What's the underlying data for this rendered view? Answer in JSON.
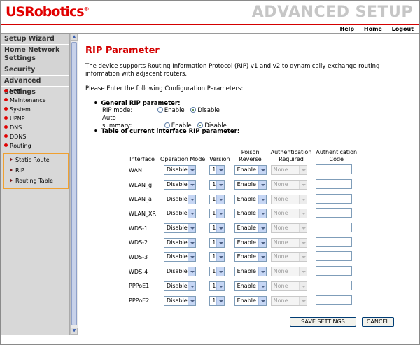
{
  "header": {
    "logo": "USRobotics",
    "logo_mark": "®",
    "title": "ADVANCED SETUP",
    "links": [
      "Help",
      "Home",
      "Logout"
    ]
  },
  "sidebar": {
    "heads": [
      "Setup Wizard",
      "Home Network Settings",
      "Security",
      "Advanced Settings"
    ],
    "items": [
      "NAT",
      "Maintenance",
      "System",
      "UPNP",
      "DNS",
      "DDNS",
      "Routing"
    ],
    "submenu": [
      "Static Route",
      "RIP",
      "Routing Table"
    ]
  },
  "main": {
    "title": "RIP Parameter",
    "description": "The device supports Routing Information Protocol (RIP) v1 and v2 to dynamically exchange routing information with adjacent routers.",
    "intro": "Please Enter the following Configuration Parameters:",
    "general_title": "General RIP parameter:",
    "rip_mode": {
      "label": "RIP mode:",
      "options": [
        "Enable",
        "Disable"
      ],
      "selected": "Disable"
    },
    "auto_summary": {
      "label": "Auto summary:",
      "options": [
        "Enable",
        "Disable"
      ],
      "selected": "Disable"
    },
    "table_title": "Table of current interface RIP parameter:"
  },
  "table": {
    "headers": [
      "Interface",
      "Operation Mode",
      "Version",
      "Poison Reverse",
      "Authentication Required",
      "Authentication Code"
    ],
    "rows": [
      {
        "iface": "WAN",
        "mode": "Disable",
        "version": "1",
        "poison": "Enable",
        "auth": "None",
        "code": ""
      },
      {
        "iface": "WLAN_g",
        "mode": "Disable",
        "version": "1",
        "poison": "Enable",
        "auth": "None",
        "code": ""
      },
      {
        "iface": "WLAN_a",
        "mode": "Disable",
        "version": "1",
        "poison": "Enable",
        "auth": "None",
        "code": ""
      },
      {
        "iface": "WLAN_XR",
        "mode": "Disable",
        "version": "1",
        "poison": "Enable",
        "auth": "None",
        "code": ""
      },
      {
        "iface": "WDS-1",
        "mode": "Disable",
        "version": "1",
        "poison": "Enable",
        "auth": "None",
        "code": ""
      },
      {
        "iface": "WDS-2",
        "mode": "Disable",
        "version": "1",
        "poison": "Enable",
        "auth": "None",
        "code": ""
      },
      {
        "iface": "WDS-3",
        "mode": "Disable",
        "version": "1",
        "poison": "Enable",
        "auth": "None",
        "code": ""
      },
      {
        "iface": "WDS-4",
        "mode": "Disable",
        "version": "1",
        "poison": "Enable",
        "auth": "None",
        "code": ""
      },
      {
        "iface": "PPPoE1",
        "mode": "Disable",
        "version": "1",
        "poison": "Enable",
        "auth": "None",
        "code": ""
      },
      {
        "iface": "PPPoE2",
        "mode": "Disable",
        "version": "1",
        "poison": "Enable",
        "auth": "None",
        "code": ""
      }
    ]
  },
  "buttons": {
    "save": "SAVE SETTINGS",
    "cancel": "CANCEL"
  },
  "colors": {
    "brand_red": "#d40000",
    "sidebar_bg": "#d8d8d8",
    "submenu_border": "#f0a030"
  }
}
